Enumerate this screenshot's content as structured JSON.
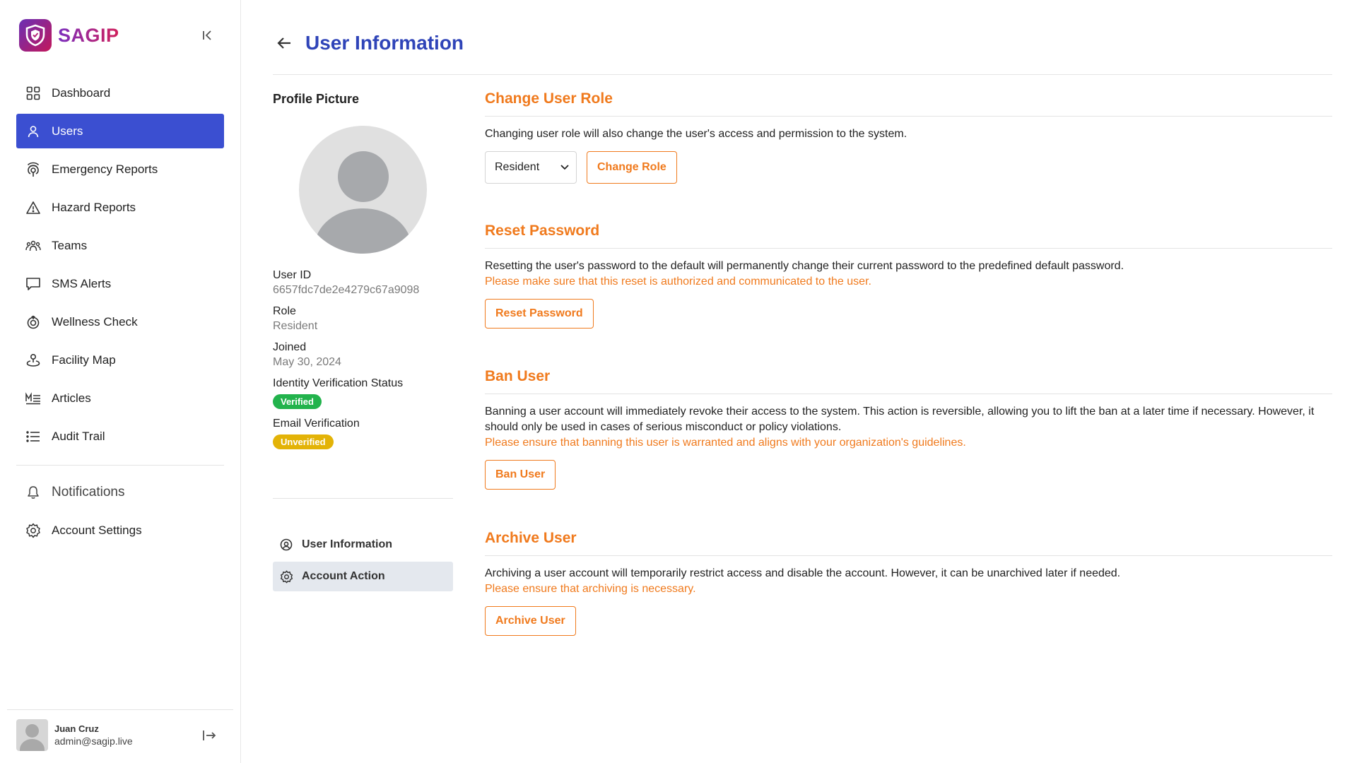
{
  "brand": {
    "name": "SAGIP",
    "logo_icon": "shield-icon"
  },
  "sidebar": {
    "items": [
      {
        "label": "Dashboard",
        "icon": "grid-icon"
      },
      {
        "label": "Users",
        "icon": "user-icon",
        "active": true
      },
      {
        "label": "Emergency Reports",
        "icon": "location-signal-icon"
      },
      {
        "label": "Hazard Reports",
        "icon": "warning-icon"
      },
      {
        "label": "Teams",
        "icon": "team-icon"
      },
      {
        "label": "SMS Alerts",
        "icon": "message-icon"
      },
      {
        "label": "Wellness Check",
        "icon": "wellness-icon"
      },
      {
        "label": "Facility Map",
        "icon": "map-pin-icon"
      },
      {
        "label": "Articles",
        "icon": "articles-icon"
      },
      {
        "label": "Audit Trail",
        "icon": "list-icon"
      }
    ],
    "secondary": [
      {
        "label": "Notifications",
        "icon": "bell-icon"
      },
      {
        "label": "Account Settings",
        "icon": "gear-icon"
      }
    ],
    "user": {
      "name": "Juan Cruz",
      "email": "admin@sagip.live"
    }
  },
  "header": {
    "title": "User Information"
  },
  "profile": {
    "section_label": "Profile Picture",
    "user_id_label": "User ID",
    "user_id": "6657fdc7de2e4279c67a9098",
    "role_label": "Role",
    "role": "Resident",
    "joined_label": "Joined",
    "joined": "May 30, 2024",
    "identity_label": "Identity Verification Status",
    "identity_status": "Verified",
    "email_label": "Email Verification",
    "email_status": "Unverified"
  },
  "subnav": [
    {
      "label": "User Information",
      "icon": "user-circle-icon"
    },
    {
      "label": "Account Action",
      "icon": "gear-icon",
      "active": true
    }
  ],
  "actions": {
    "change_role": {
      "title": "Change User Role",
      "desc": "Changing user role will also change the user's access and permission to the system.",
      "selected_role": "Resident",
      "button": "Change Role"
    },
    "reset_password": {
      "title": "Reset Password",
      "desc": "Resetting the user's password to the default will permanently change their current password to the predefined default password.",
      "warning": "Please make sure that this reset is authorized and communicated to the user.",
      "button": "Reset Password"
    },
    "ban_user": {
      "title": "Ban User",
      "desc": "Banning a user account will immediately revoke their access to the system. This action is reversible, allowing you to lift the ban at a later time if necessary. However, it should only be used in cases of serious misconduct or policy violations.",
      "warning": "Please ensure that banning this user is warranted and aligns with your organization's guidelines.",
      "button": "Ban User"
    },
    "archive_user": {
      "title": "Archive User",
      "desc": "Archiving a user account will temporarily restrict access and disable the account. However, it can be unarchived later if needed.",
      "warning": "Please ensure that archiving is necessary.",
      "button": "Archive User"
    }
  },
  "colors": {
    "primary": "#3b4fd1",
    "title": "#2f44b8",
    "accent_orange": "#f07a1d",
    "verified": "#22b34c",
    "unverified": "#e3b307"
  }
}
